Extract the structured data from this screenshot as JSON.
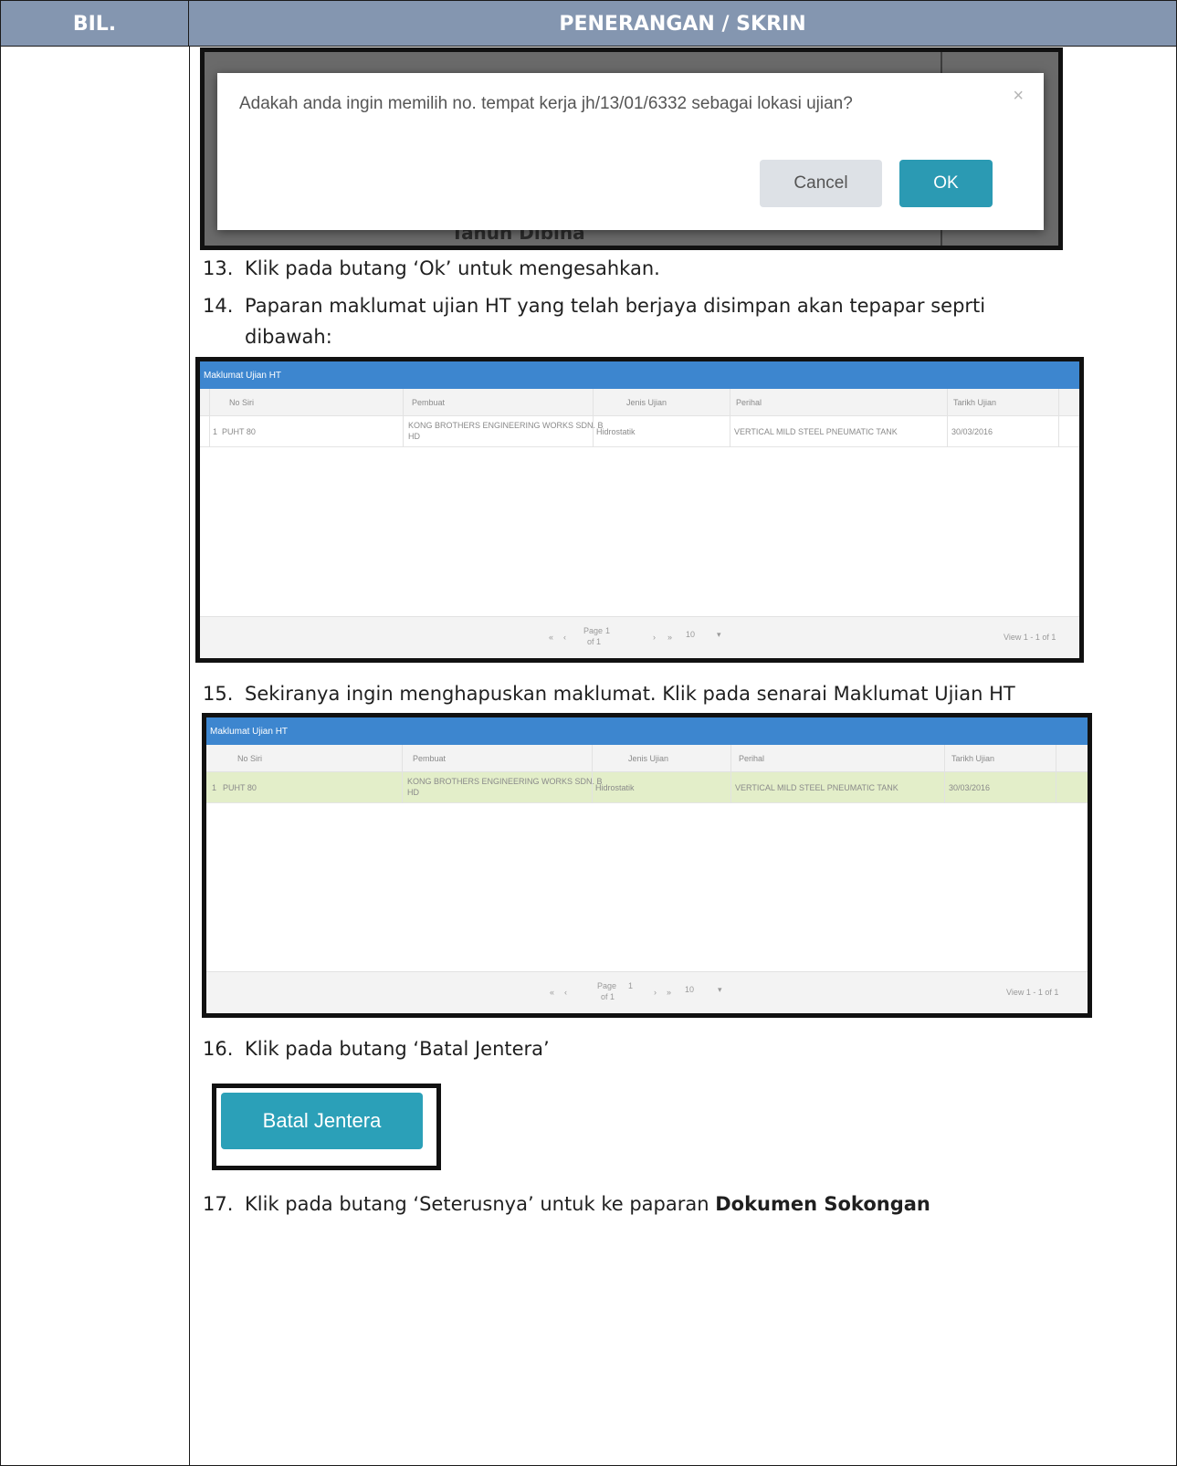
{
  "header": {
    "col_bil": "BIL.",
    "col_penerangan": "PENERANGAN / SKRIN"
  },
  "dialog": {
    "message": "Adakah anda ingin memilih no. tempat kerja jh/13/01/6332 sebagai lokasi ujian?",
    "background_text": "Tahun Dibina",
    "close_glyph": "×",
    "cancel_label": "Cancel",
    "ok_label": "OK"
  },
  "steps": {
    "s13": {
      "num": "13.",
      "text": "Klik pada butang ‘Ok’ untuk mengesahkan."
    },
    "s14": {
      "num": "14.",
      "text_line1": "Paparan maklumat ujian HT yang telah berjaya disimpan akan tepapar seprti",
      "text_line2": "dibawah:"
    },
    "s15": {
      "num": "15.",
      "text": "Sekiranya ingin menghapuskan maklumat. Klik pada senarai Maklumat Ujian HT"
    },
    "s16": {
      "num": "16.",
      "text": "Klik pada butang ‘Batal Jentera’"
    },
    "s17": {
      "num": "17.",
      "text_before": "Klik pada butang ‘Seterusnya’ untuk ke paparan ",
      "text_bold": "Dokumen Sokongan"
    }
  },
  "grid": {
    "title": "Maklumat Ujian HT",
    "columns": [
      "No Siri",
      "Pembuat",
      "Jenis Ujian",
      "Perihal",
      "Tarikh Ujian"
    ],
    "rows": [
      {
        "index": "1",
        "no_siri": "PUHT 80",
        "pembuat_line1": "KONG BROTHERS ENGINEERING WORKS SDN. B",
        "pembuat_line2": "HD",
        "jenis_ujian": "Hidrostatik",
        "perihal": "VERTICAL MILD STEEL PNEUMATIC TANK",
        "tarikh_ujian": "30/03/2016"
      }
    ],
    "pager": {
      "first": "«",
      "prev": "‹",
      "page_label": "Page",
      "page_value": "1",
      "of_label": "of 1",
      "next": "›",
      "last": "»",
      "page_size": "10",
      "dropdown_glyph": "▾",
      "view_text_a": "View 1 - 1 of 1",
      "view_text_b": "View 1 - 1 of 1"
    }
  },
  "batal_button": {
    "label": "Batal Jentera"
  },
  "colors": {
    "header_bg": "#8496b0",
    "grid_titlebar": "#3d86cf",
    "ok_button": "#2b9ab3",
    "batal_button": "#2ba0b8",
    "selected_row": "#e3eec9"
  }
}
